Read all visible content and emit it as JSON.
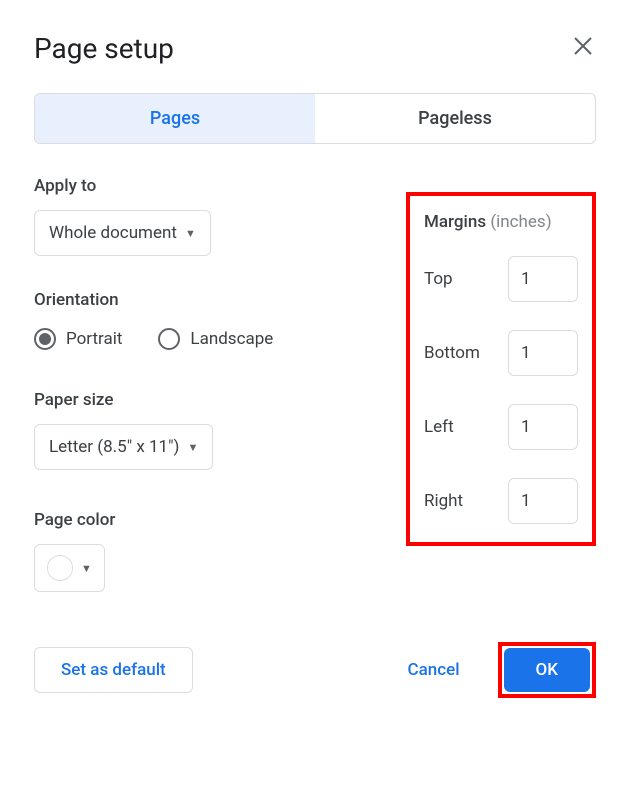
{
  "dialog": {
    "title": "Page setup"
  },
  "tabs": {
    "pages": "Pages",
    "pageless": "Pageless"
  },
  "applyTo": {
    "label": "Apply to",
    "value": "Whole document"
  },
  "orientation": {
    "label": "Orientation",
    "portrait": "Portrait",
    "landscape": "Landscape",
    "selected": "portrait"
  },
  "paperSize": {
    "label": "Paper size",
    "value": "Letter (8.5\" x 11\")"
  },
  "pageColor": {
    "label": "Page color",
    "value": "#ffffff"
  },
  "margins": {
    "label": "Margins",
    "unit": "(inches)",
    "top": {
      "label": "Top",
      "value": "1"
    },
    "bottom": {
      "label": "Bottom",
      "value": "1"
    },
    "left": {
      "label": "Left",
      "value": "1"
    },
    "right": {
      "label": "Right",
      "value": "1"
    }
  },
  "buttons": {
    "setDefault": "Set as default",
    "cancel": "Cancel",
    "ok": "OK"
  }
}
